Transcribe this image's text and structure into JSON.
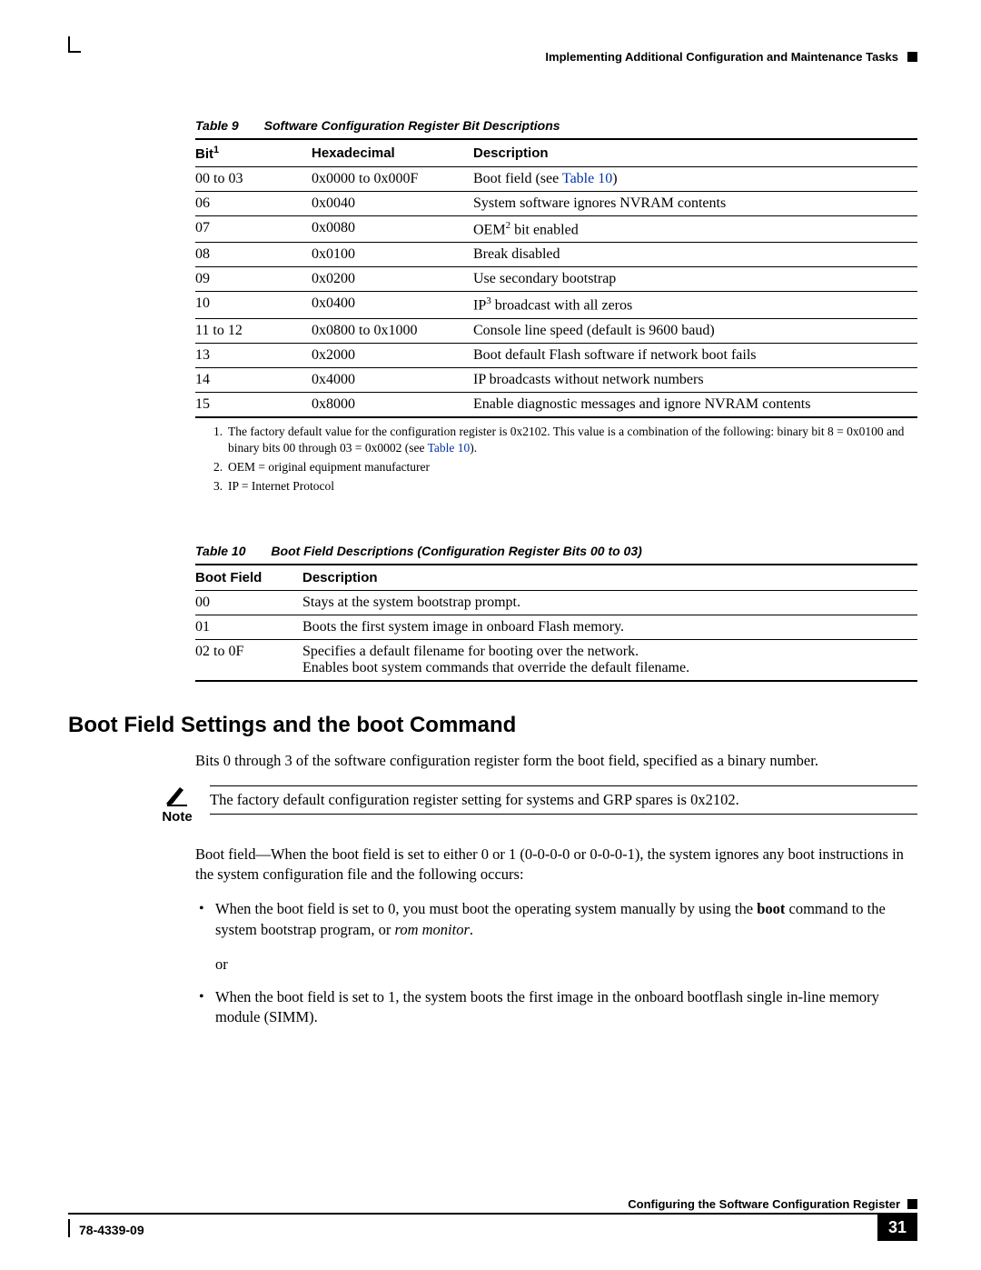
{
  "header": {
    "running_title": "Implementing Additional Configuration and Maintenance Tasks"
  },
  "table9": {
    "caption_label": "Table 9",
    "caption_text": "Software Configuration Register Bit Descriptions",
    "headers": {
      "c1": "Bit",
      "c1_sup": "1",
      "c2": "Hexadecimal",
      "c3": "Description"
    },
    "rows": [
      {
        "c1": "00 to 03",
        "c2": "0x0000 to 0x000F",
        "c3_pre": "Boot field (see ",
        "c3_link": "Table 10",
        "c3_post": ")"
      },
      {
        "c1": "06",
        "c2": "0x0040",
        "c3": "System software ignores NVRAM contents"
      },
      {
        "c1": "07",
        "c2": "0x0080",
        "c3_pre": "OEM",
        "c3_sup": "2",
        "c3_post": " bit enabled"
      },
      {
        "c1": "08",
        "c2": "0x0100",
        "c3": "Break disabled"
      },
      {
        "c1": "09",
        "c2": "0x0200",
        "c3": "Use secondary bootstrap"
      },
      {
        "c1": "10",
        "c2": "0x0400",
        "c3_pre": "IP",
        "c3_sup": "3",
        "c3_post": " broadcast with all zeros"
      },
      {
        "c1": "11 to 12",
        "c2": "0x0800 to 0x1000",
        "c3": "Console line speed (default is 9600 baud)"
      },
      {
        "c1": "13",
        "c2": "0x2000",
        "c3": "Boot default Flash software if network boot fails"
      },
      {
        "c1": "14",
        "c2": "0x4000",
        "c3": "IP broadcasts without network numbers"
      },
      {
        "c1": "15",
        "c2": "0x8000",
        "c3": "Enable diagnostic messages and ignore NVRAM contents"
      }
    ],
    "footnotes": {
      "f1_num": "1.",
      "f1_text_a": "The factory default value for the configuration register is 0x2102. This value is a combination of the following: binary bit 8 = 0x0100 and binary bits 00 through 03 = 0x0002 (see ",
      "f1_link": "Table 10",
      "f1_text_b": ").",
      "f2_num": "2.",
      "f2_text": "OEM = original equipment manufacturer",
      "f3_num": "3.",
      "f3_text": "IP = Internet Protocol"
    }
  },
  "table10": {
    "caption_label": "Table 10",
    "caption_text": "Boot Field Descriptions (Configuration Register Bits 00 to 03)",
    "headers": {
      "c1": "Boot Field",
      "c2": "Description"
    },
    "rows": [
      {
        "c1": "00",
        "c2": "Stays at the system bootstrap prompt."
      },
      {
        "c1": "01",
        "c2": "Boots the first system image in onboard Flash memory."
      },
      {
        "c1": "02 to 0F",
        "c2a": "Specifies a default filename for booting over the network.",
        "c2b": "Enables boot system commands that override the default filename."
      }
    ]
  },
  "section": {
    "heading": "Boot Field Settings and the boot Command",
    "intro": "Bits 0 through 3 of the software configuration register form the boot field, specified as a binary number.",
    "note_label": "Note",
    "note_text": "The factory default configuration register setting for systems and GRP spares is 0x2102.",
    "boot_field_para": "Boot field—When the boot field is set to either 0 or 1 (0-0-0-0 or 0-0-0-1), the system ignores any boot instructions in the system configuration file and the following occurs:",
    "bullet1_a": "When the boot field is set to 0, you must boot the operating system manually by using the ",
    "bullet1_bold": "boot",
    "bullet1_b": " command to the system bootstrap program, or ",
    "bullet1_italic": "rom monitor",
    "bullet1_c": ".",
    "or_text": "or",
    "bullet2": "When the boot field is set to 1, the system boots the first image in the onboard bootflash single in-line memory module (SIMM)."
  },
  "footer": {
    "section_title": "Configuring the Software Configuration Register",
    "docnum": "78-4339-09",
    "pagenum": "31"
  }
}
